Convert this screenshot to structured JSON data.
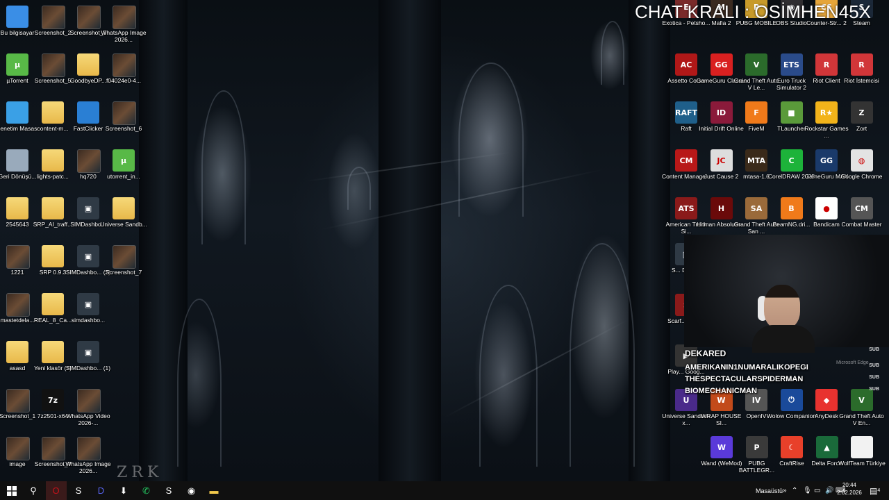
{
  "overlay": {
    "title": "CHAT KRALI : OSİMHEN45X"
  },
  "desktop_left": [
    {
      "label": "Bu bilgisayar",
      "icon": "computer-icon",
      "kind": "sys",
      "color": "#3a8ee6"
    },
    {
      "label": "Screenshot_2",
      "icon": "screenshot-thumbnail",
      "kind": "shot"
    },
    {
      "label": "Screenshot_3",
      "icon": "screenshot-thumbnail",
      "kind": "shot"
    },
    {
      "label": "WhatsApp Image 2026...",
      "icon": "image-thumbnail",
      "kind": "shot"
    },
    {
      "label": "µTorrent",
      "icon": "utorrent-icon",
      "kind": "app",
      "color": "#58b947",
      "glyph": "µ"
    },
    {
      "label": "Screenshot_5",
      "icon": "screenshot-thumbnail",
      "kind": "shot"
    },
    {
      "label": "GoodbyeDP...",
      "icon": "folder-icon",
      "kind": "folder"
    },
    {
      "label": "f04024e0-4...",
      "icon": "image-thumbnail",
      "kind": "shot"
    },
    {
      "label": "Denetim Masası",
      "icon": "control-panel-icon",
      "kind": "sys",
      "color": "#3aa0e6"
    },
    {
      "label": "content-m...",
      "icon": "folder-icon",
      "kind": "folder"
    },
    {
      "label": "FastClicker",
      "icon": "fastclicker-icon",
      "kind": "sys",
      "color": "#2a7fd4"
    },
    {
      "label": "Screenshot_6",
      "icon": "screenshot-thumbnail",
      "kind": "shot"
    },
    {
      "label": "Geri Dönüşü...",
      "icon": "recycle-bin-icon",
      "kind": "sys",
      "color": "#9ab"
    },
    {
      "label": "lights-patc...",
      "icon": "folder-icon",
      "kind": "folder"
    },
    {
      "label": "hq720",
      "icon": "image-thumbnail",
      "kind": "shot"
    },
    {
      "label": "utorrent_in...",
      "icon": "utorrent-icon",
      "kind": "app",
      "color": "#58b947",
      "glyph": "µ"
    },
    {
      "label": "2545643",
      "icon": "folder-icon",
      "kind": "folder"
    },
    {
      "label": "SRP_AI_traff...",
      "icon": "folder-icon",
      "kind": "folder"
    },
    {
      "label": "SIMDashbo...",
      "icon": "simdashboard-icon",
      "kind": "app",
      "color": "#2f3a45",
      "glyph": "▣"
    },
    {
      "label": "Universe Sandb...",
      "icon": "folder-icon",
      "kind": "folder"
    },
    {
      "label": "1221",
      "icon": "image-thumbnail",
      "kind": "shot"
    },
    {
      "label": "SRP 0.9.3",
      "icon": "folder-icon",
      "kind": "folder"
    },
    {
      "label": "SIMDashbo... (2)",
      "icon": "simdashboard-icon",
      "kind": "app",
      "color": "#2f3a45",
      "glyph": "▣"
    },
    {
      "label": "Screenshot_7",
      "icon": "screenshot-thumbnail",
      "kind": "shot"
    },
    {
      "label": "mastetdela...",
      "icon": "image-thumbnail",
      "kind": "shot"
    },
    {
      "label": "REAL_8_Ca...",
      "icon": "folder-icon",
      "kind": "folder"
    },
    {
      "label": "simdashbo...",
      "icon": "simdashboard-icon",
      "kind": "app",
      "color": "#2f3a45",
      "glyph": "▣"
    },
    {
      "label": "",
      "icon": "empty-slot",
      "kind": "none"
    },
    {
      "label": "asasd",
      "icon": "folder-icon",
      "kind": "folder"
    },
    {
      "label": "Yeni klasör (2)",
      "icon": "folder-icon",
      "kind": "folder"
    },
    {
      "label": "SIMDashbo... (1)",
      "icon": "simdashboard-icon",
      "kind": "app",
      "color": "#2f3a45",
      "glyph": "▣"
    },
    {
      "label": "",
      "icon": "empty-slot",
      "kind": "none"
    },
    {
      "label": "Screenshot_1",
      "icon": "screenshot-thumbnail",
      "kind": "shot"
    },
    {
      "label": "7z2501-x64",
      "icon": "7zip-icon",
      "kind": "app",
      "color": "#111",
      "glyph": "7z"
    },
    {
      "label": "WhatsApp Video 2026-...",
      "icon": "video-thumbnail",
      "kind": "shot"
    },
    {
      "label": "",
      "icon": "empty-slot",
      "kind": "none"
    },
    {
      "label": "image",
      "icon": "image-thumbnail",
      "kind": "shot"
    },
    {
      "label": "Screenshot_4",
      "icon": "screenshot-thumbnail",
      "kind": "shot"
    },
    {
      "label": "WhatsApp Image 2026...",
      "icon": "image-thumbnail",
      "kind": "shot"
    },
    {
      "label": "",
      "icon": "empty-slot",
      "kind": "none"
    }
  ],
  "desktop_right": [
    {
      "label": "Exotica - Petsho...",
      "icon": "game-icon",
      "color": "#7a2a2a",
      "glyph": "E"
    },
    {
      "label": "Mafia 2",
      "icon": "mafia2-icon",
      "color": "#3a2a20",
      "glyph": "M"
    },
    {
      "label": "PUBG MOBILE",
      "icon": "pubg-mobile-icon",
      "color": "#c79a2a",
      "glyph": "P"
    },
    {
      "label": "OBS Studio",
      "icon": "obs-icon",
      "color": "#302e31",
      "glyph": "◉"
    },
    {
      "label": "Counter-Str... 2",
      "icon": "cs2-icon",
      "color": "#e5a53a",
      "glyph": "CS"
    },
    {
      "label": "Steam",
      "icon": "steam-icon",
      "color": "#1b2838",
      "glyph": "S"
    },
    {
      "label": "Assetto Corsa",
      "icon": "assetto-corsa-icon",
      "color": "#b01818",
      "glyph": "AC"
    },
    {
      "label": "GameGuru Classic",
      "icon": "gameguru-icon",
      "color": "#d92020",
      "glyph": "GG"
    },
    {
      "label": "Grand Theft Auto V Le...",
      "icon": "gta5-icon",
      "color": "#2b6b2b",
      "glyph": "V"
    },
    {
      "label": "Euro Truck Simulator 2",
      "icon": "ets2-icon",
      "color": "#2a4b8a",
      "glyph": "ETS"
    },
    {
      "label": "Riot Client",
      "icon": "riot-client-icon",
      "color": "#d13639",
      "glyph": "R"
    },
    {
      "label": "Riot İstemcisi",
      "icon": "riot-client-icon",
      "color": "#d13639",
      "glyph": "R"
    },
    {
      "label": "Raft",
      "icon": "raft-icon",
      "color": "#1f5f8a",
      "glyph": "RAFT"
    },
    {
      "label": "Initial Drift Online",
      "icon": "initial-drift-icon",
      "color": "#8a1a3a",
      "glyph": "ID"
    },
    {
      "label": "FiveM",
      "icon": "fivem-icon",
      "color": "#f07a1a",
      "glyph": "F"
    },
    {
      "label": "TLauncher",
      "icon": "tlauncher-icon",
      "color": "#5a9a3a",
      "glyph": "■"
    },
    {
      "label": "Rockstar Games ...",
      "icon": "rockstar-icon",
      "color": "#f2b31a",
      "glyph": "R★"
    },
    {
      "label": "Zort",
      "icon": "zort-icon",
      "color": "#333",
      "glyph": "Z"
    },
    {
      "label": "Content Manage...",
      "icon": "content-manager-icon",
      "color": "#b81818",
      "glyph": "CM"
    },
    {
      "label": "Just Cause 2",
      "icon": "just-cause-icon",
      "color": "#ddd",
      "glyph": "JC"
    },
    {
      "label": "mtasa-1.6",
      "icon": "mta-icon",
      "color": "#3a2a1a",
      "glyph": "MTA"
    },
    {
      "label": "CorelDRAW 2025",
      "icon": "coreldraw-icon",
      "color": "#1db33a",
      "glyph": "C"
    },
    {
      "label": "GameGuru MAX",
      "icon": "gameguru-max-icon",
      "color": "#1a3a6a",
      "glyph": "GG"
    },
    {
      "label": "Google Chrome",
      "icon": "chrome-icon",
      "color": "#e3e3e3",
      "glyph": "◍"
    },
    {
      "label": "American Truck Si...",
      "icon": "ats-icon",
      "color": "#8a1a1a",
      "glyph": "ATS"
    },
    {
      "label": "Hitman Absolutio...",
      "icon": "hitman-icon",
      "color": "#6a0a0a",
      "glyph": "H"
    },
    {
      "label": "Grand Theft Auto San ...",
      "icon": "gta-sa-icon",
      "color": "#9a6a3a",
      "glyph": "SA"
    },
    {
      "label": "BeamNG.dri...",
      "icon": "beamng-icon",
      "color": "#f07a1a",
      "glyph": "B"
    },
    {
      "label": "Bandicam",
      "icon": "bandicam-icon",
      "color": "#fff",
      "glyph": "●"
    },
    {
      "label": "Combat Master",
      "icon": "combat-master-icon",
      "color": "#555",
      "glyph": "CM"
    }
  ],
  "desktop_right_col1": [
    {
      "label": "S... Dash...",
      "icon": "simdashboard-icon",
      "color": "#2f3a45",
      "glyph": "▣"
    },
    {
      "label": "Scarf... Worl...",
      "icon": "game-icon",
      "color": "#8a1a1a",
      "glyph": "S"
    },
    {
      "label": "Play... Goog...",
      "icon": "google-play-icon",
      "color": "#333",
      "glyph": "▶"
    }
  ],
  "desktop_bottom_right": [
    {
      "label": "Universe Sandbox x...",
      "icon": "universe-sandbox-icon",
      "color": "#4a2a8a",
      "glyph": "U"
    },
    {
      "label": "WRAP HOUSE SI...",
      "icon": "wrap-house-icon",
      "color": "#c24a1a",
      "glyph": "W"
    },
    {
      "label": "OpenIV",
      "icon": "openiv-icon",
      "color": "#555",
      "glyph": "IV"
    },
    {
      "label": "Wolow Companion",
      "icon": "wolow-icon",
      "color": "#1a4a9a",
      "glyph": "⏻"
    },
    {
      "label": "AnyDesk",
      "icon": "anydesk-icon",
      "color": "#e8322f",
      "glyph": "◆"
    },
    {
      "label": "Grand Theft Auto V En...",
      "icon": "gta5-icon",
      "color": "#2b6b2b",
      "glyph": "V"
    },
    {
      "label": "Wand (WeMod)",
      "icon": "wand-icon",
      "color": "#5a3ad9",
      "glyph": "W"
    },
    {
      "label": "PUBG BATTLEGR...",
      "icon": "pubg-icon",
      "color": "#3a3a3a",
      "glyph": "P"
    },
    {
      "label": "CraftRise",
      "icon": "craftrise-icon",
      "color": "#e8402a",
      "glyph": "☾"
    },
    {
      "label": "Delta Force",
      "icon": "delta-force-icon",
      "color": "#1a6a3a",
      "glyph": "▲"
    },
    {
      "label": "WolfTeam Türkiye",
      "icon": "document-icon",
      "color": "#f2f2f2",
      "glyph": ""
    }
  ],
  "chat": {
    "header": "DEKARED",
    "rows": [
      {
        "name": "AMERIKANIN1NUMARALIKOPEGI",
        "badge": "SUB"
      },
      {
        "name": "THESPECTACULARSPIDERMAN",
        "badge": "SUB"
      },
      {
        "name": "BIOMECHANICMAN",
        "badge": "SUB"
      }
    ],
    "header_badge": "SUB",
    "behind_text": "Microsoft Edge"
  },
  "watermark": "ZRK",
  "taskbar": {
    "start_icon": "windows-start-icon",
    "items": [
      {
        "name": "search-icon",
        "glyph": "⚲"
      },
      {
        "name": "opera-gx-icon",
        "glyph": "O"
      },
      {
        "name": "steam-icon",
        "glyph": "S"
      },
      {
        "name": "discord-icon",
        "glyph": "D"
      },
      {
        "name": "store-icon",
        "glyph": "⬇"
      },
      {
        "name": "whatsapp-icon",
        "glyph": "✆"
      },
      {
        "name": "steam-icon-2",
        "glyph": "S"
      },
      {
        "name": "obs-icon",
        "glyph": "◉"
      },
      {
        "name": "file-explorer-icon",
        "glyph": "▬"
      }
    ],
    "desktop_label": "Masaüstü",
    "time": "20:44",
    "date": "2.02.2026",
    "notif_count": "4"
  },
  "colors": {
    "taskbar": "#101010",
    "accent": "#0078d4",
    "chat_text": "#ffffff"
  }
}
